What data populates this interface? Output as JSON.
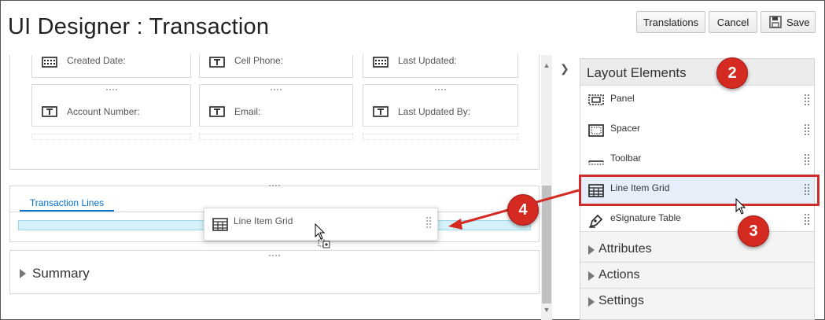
{
  "header": {
    "title": "UI Designer : Transaction",
    "translations_label": "Translations",
    "cancel_label": "Cancel",
    "save_label": "Save"
  },
  "canvas": {
    "fields_row1": [
      "Created Date:",
      "Cell Phone:",
      "Last Updated:"
    ],
    "fields_row2": [
      "Account Number:",
      "Email:",
      "Last Updated By:"
    ],
    "tab_label": "Transaction Lines",
    "drag_ghost_label": "Line Item Grid",
    "summary_label": "Summary"
  },
  "layout_elements": {
    "title": "Layout Elements",
    "items": [
      {
        "label": "Panel",
        "icon": "panel-icon"
      },
      {
        "label": "Spacer",
        "icon": "spacer-icon"
      },
      {
        "label": "Toolbar",
        "icon": "toolbar-icon"
      },
      {
        "label": "Line Item Grid",
        "icon": "grid-icon",
        "selected": true
      },
      {
        "label": "eSignature Table",
        "icon": "esignature-icon"
      }
    ]
  },
  "accordions": [
    "Attributes",
    "Actions",
    "Settings"
  ],
  "callouts": {
    "badge_2": "2",
    "badge_3": "3",
    "badge_4": "4",
    "color": "#d42a22"
  },
  "colors": {
    "accent": "#0572ce",
    "drop_zone": "#d5f1f9",
    "selection": "#e5eef9",
    "highlight": "#d12c2c"
  }
}
